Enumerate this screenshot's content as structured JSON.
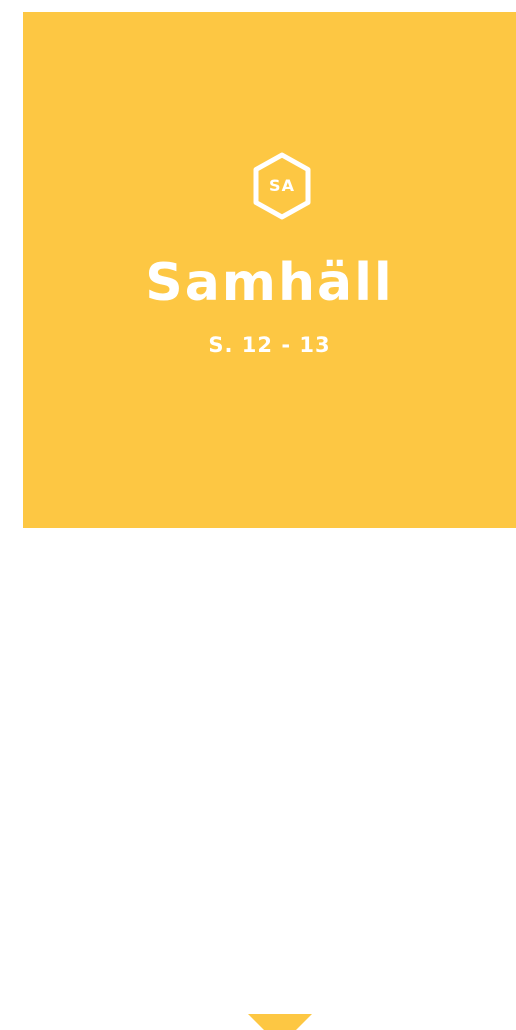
{
  "card": {
    "background_color": "#fdc743",
    "badge": {
      "label": "SA",
      "icon": "hexagon-icon"
    },
    "title": "Samhäll",
    "pages": "S. 12 - 13",
    "expand_icon": "chevron-down-icon"
  }
}
